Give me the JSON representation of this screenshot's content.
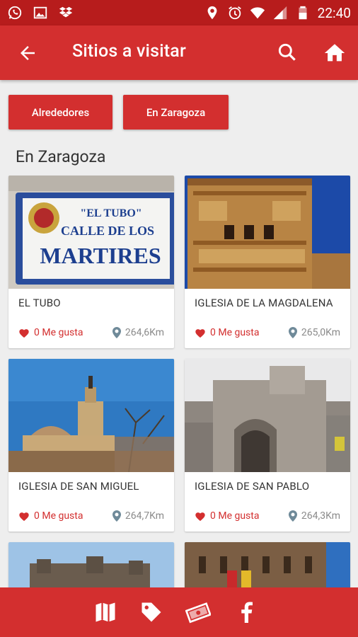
{
  "status": {
    "time": "22:40"
  },
  "appbar": {
    "title": "Sitios a visitar"
  },
  "filters": {
    "left_label": "Alrededores",
    "right_label": "En Zaragoza"
  },
  "section": {
    "title": "En Zaragoza"
  },
  "cards": [
    {
      "name": "EL TUBO",
      "likes": "0 Me gusta",
      "distance": "264,6Km"
    },
    {
      "name": "IGLESIA DE LA MAGDALENA",
      "likes": "0 Me gusta",
      "distance": "265,0Km"
    },
    {
      "name": "IGLESIA DE SAN MIGUEL",
      "likes": "0 Me gusta",
      "distance": "264,7Km"
    },
    {
      "name": "IGLESIA DE SAN PABLO",
      "likes": "0 Me gusta",
      "distance": "264,3Km"
    }
  ],
  "sign": {
    "line1": "\"EL TUBO\"",
    "line2": "CALLE DE LOS",
    "line3": "MARTIRES"
  },
  "colors": {
    "primary": "#d32f2f",
    "status_bar": "#b71c1c",
    "distance": "#8a8a8a"
  },
  "icons": {
    "status": [
      "whatsapp-icon",
      "image-icon",
      "dropbox-icon",
      "location-icon",
      "alarm-icon",
      "wifi-icon",
      "signal-icon",
      "battery-icon"
    ],
    "appbar": [
      "back-arrow-icon",
      "search-icon",
      "home-icon"
    ],
    "bottom": [
      "map-icon",
      "tag-icon",
      "money-icon",
      "facebook-icon"
    ]
  }
}
